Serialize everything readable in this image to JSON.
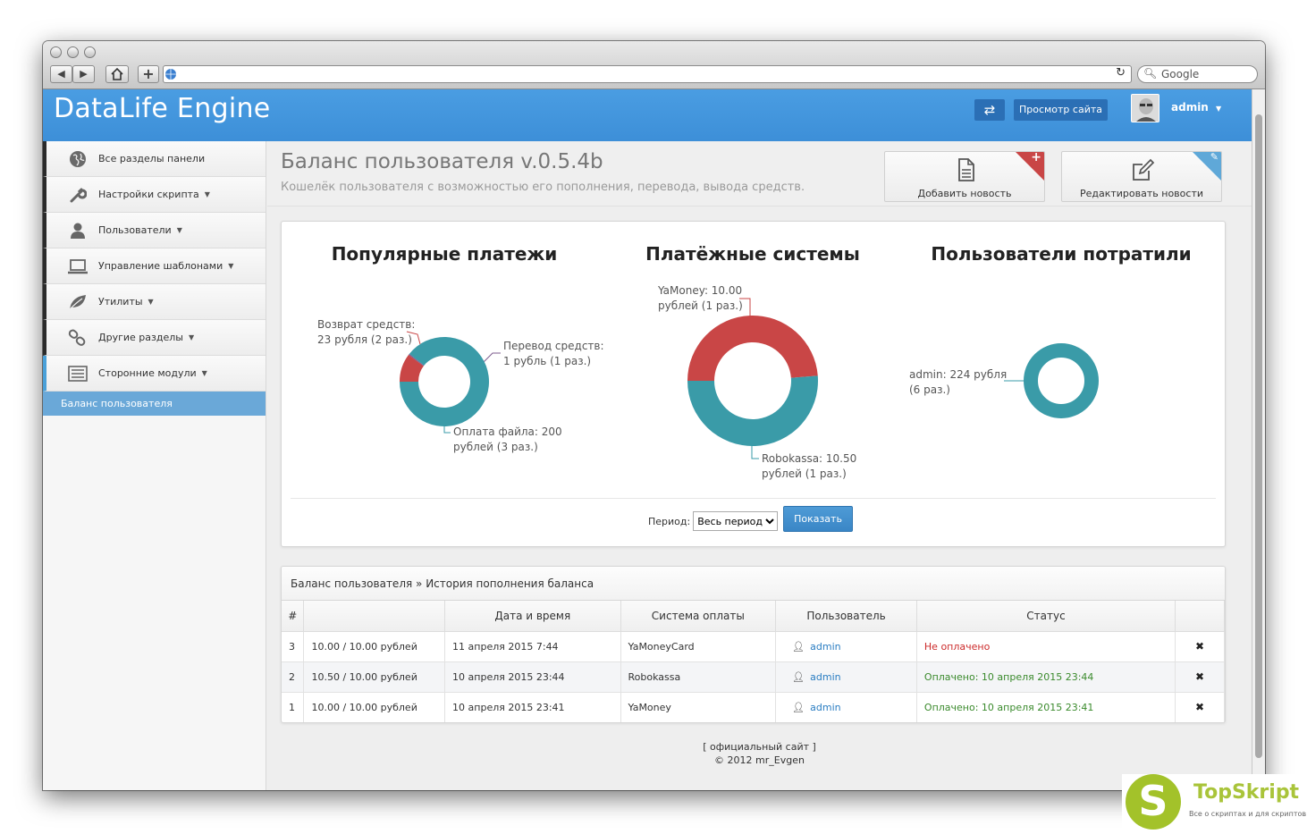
{
  "browser": {
    "search_placeholder": "Google"
  },
  "header": {
    "logo": "DataLife Engine",
    "view_site": "Просмотр сайта",
    "user": "admin"
  },
  "sidebar": {
    "items": [
      {
        "label": "Все разделы панели",
        "icon": "globe-icon",
        "caret": false
      },
      {
        "label": "Настройки скрипта",
        "icon": "wrench-icon",
        "caret": true
      },
      {
        "label": "Пользователи",
        "icon": "user-icon",
        "caret": true
      },
      {
        "label": "Управление шаблонами",
        "icon": "laptop-icon",
        "caret": true
      },
      {
        "label": "Утилиты",
        "icon": "leaf-icon",
        "caret": true
      },
      {
        "label": "Другие разделы",
        "icon": "link-icon",
        "caret": true
      },
      {
        "label": "Сторонние модули",
        "icon": "list-icon",
        "caret": true
      }
    ],
    "active": "Баланс пользователя"
  },
  "page": {
    "title": "Баланс пользователя v.0.5.4b",
    "subtitle": "Кошелёк пользователя с возможностью его пополнения, перевода, вывода средств.",
    "add_news": "Добавить новость",
    "edit_news": "Редактировать новости"
  },
  "charts": {
    "popular": {
      "title": "Популярные платежи",
      "labels": [
        "Возврат средств:",
        "23  рубля (2 раз.)",
        "Перевод средств:",
        "1 рубль (1 раз.)",
        "Оплата файла: 200",
        "рублей (3 раз.)"
      ]
    },
    "systems": {
      "title": "Платёжные системы",
      "labels": [
        "YaMoney: 10.00",
        "рублей (1 раз.)",
        "Robokassa: 10.50",
        "рублей (1 раз.)"
      ]
    },
    "spent": {
      "title": "Пользователи потратили",
      "labels": [
        "admin: 224  рубля",
        "(6 раз.)"
      ]
    }
  },
  "chart_data": [
    {
      "type": "pie",
      "title": "Популярные платежи",
      "categories": [
        "Возврат средств",
        "Перевод средств",
        "Оплата файла"
      ],
      "values": [
        23,
        1,
        200
      ],
      "counts": [
        2,
        1,
        3
      ],
      "colors": [
        "#c94646",
        "#7d5b8e",
        "#3a9ba8"
      ]
    },
    {
      "type": "pie",
      "title": "Платёжные системы",
      "categories": [
        "YaMoney",
        "Robokassa"
      ],
      "values": [
        10.0,
        10.5
      ],
      "counts": [
        1,
        1
      ],
      "colors": [
        "#c94646",
        "#3a9ba8"
      ]
    },
    {
      "type": "pie",
      "title": "Пользователи потратили",
      "categories": [
        "admin"
      ],
      "values": [
        224
      ],
      "counts": [
        6
      ],
      "colors": [
        "#3a9ba8"
      ]
    }
  ],
  "filter": {
    "label": "Период:",
    "selected": "Весь период",
    "button": "Показать"
  },
  "history": {
    "crumb_root": "Баланс пользователя",
    "crumb_sep": " » ",
    "crumb_page": "История пополнения баланса",
    "columns": [
      "#",
      "",
      "Дата и время",
      "Система оплаты",
      "Пользователь",
      "Статус",
      ""
    ],
    "rows": [
      {
        "id": "3",
        "amount": "10.00 / 10.00 рублей",
        "date": "11 апреля 2015 7:44",
        "system": "YaMoneyCard",
        "user": "admin",
        "status": "Не оплачено",
        "paid": false
      },
      {
        "id": "2",
        "amount": "10.50 / 10.00 рублей",
        "date": "10 апреля 2015 23:44",
        "system": "Robokassa",
        "user": "admin",
        "status": "Оплачено: 10 апреля 2015 23:44",
        "paid": true
      },
      {
        "id": "1",
        "amount": "10.00 / 10.00 рублей",
        "date": "10 апреля 2015 23:41",
        "system": "YaMoney",
        "user": "admin",
        "status": "Оплачено: 10 апреля 2015 23:41",
        "paid": true
      }
    ]
  },
  "footer": {
    "line1": "[ официальный сайт ]",
    "line2": "© 2012 mr_Evgen"
  },
  "watermark": {
    "letter": "S",
    "title": "TopSkript",
    "sub": "Все о скриптах и для скриптов..."
  }
}
